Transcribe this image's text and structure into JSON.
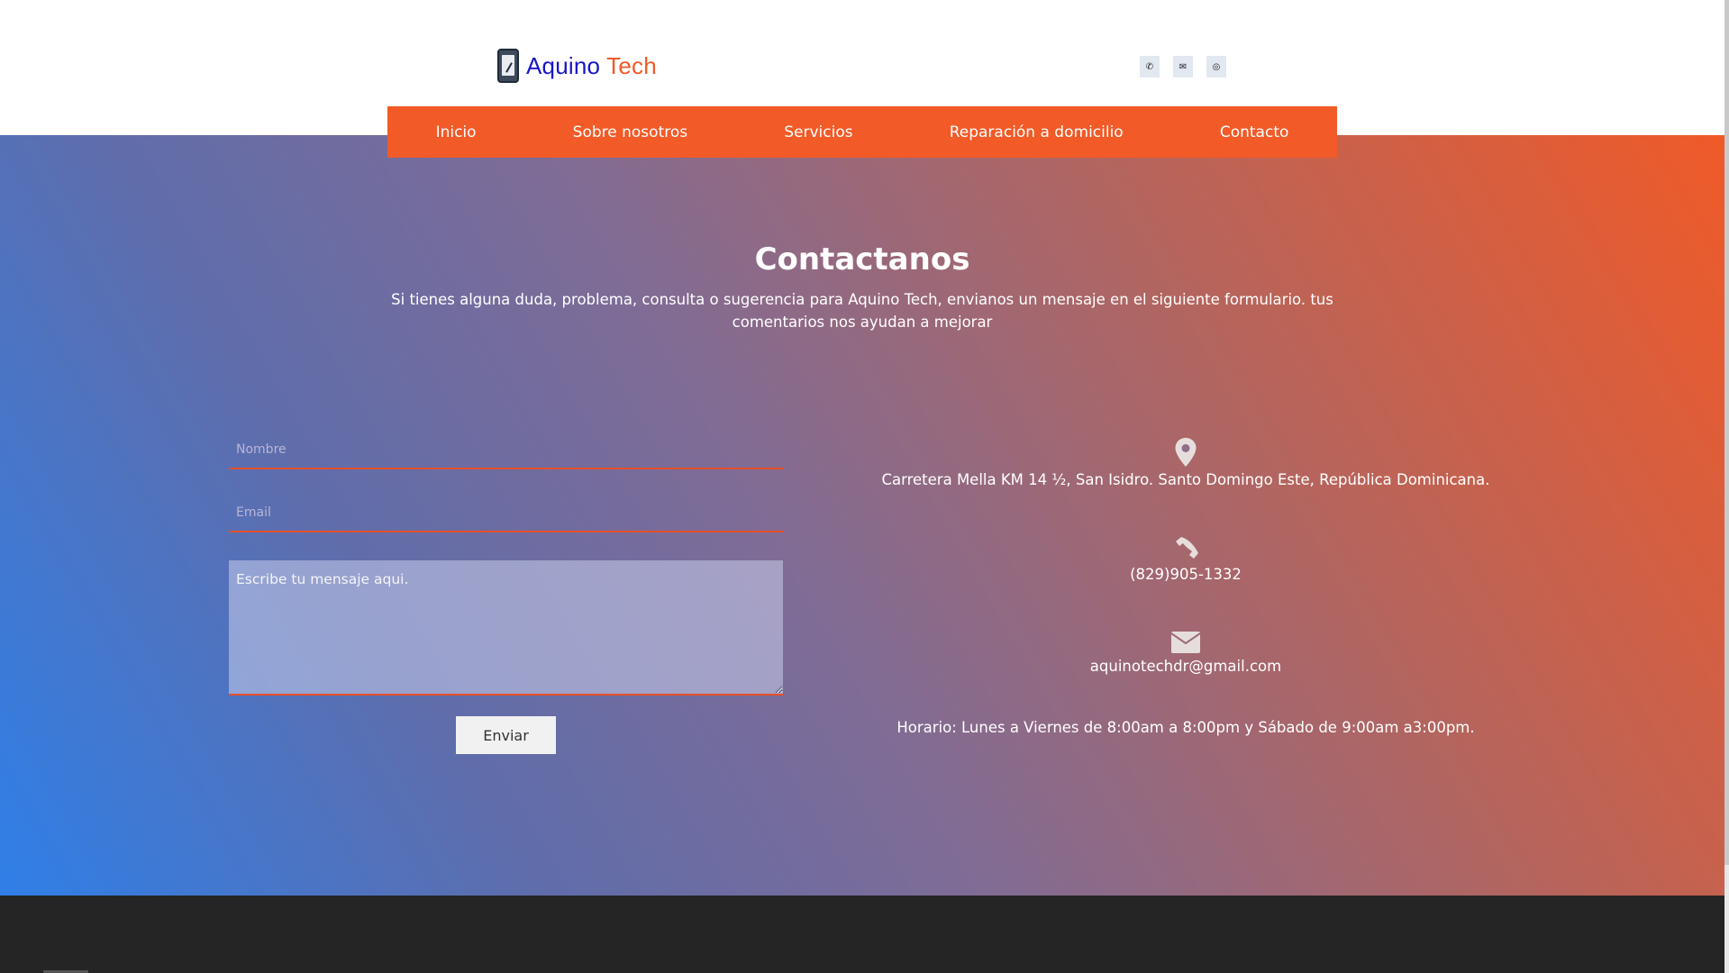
{
  "brand": {
    "name_part1": "Aquino",
    "name_part2": "Tech"
  },
  "social": [
    {
      "icon": "whatsapp-icon",
      "glyph": "✆"
    },
    {
      "icon": "mail-icon",
      "glyph": "✉"
    },
    {
      "icon": "instagram-icon",
      "glyph": "◎"
    }
  ],
  "nav": {
    "items": [
      "Inicio",
      "Sobre nosotros",
      "Servicios",
      "Reparación a domicilio",
      "Contacto"
    ]
  },
  "contact": {
    "title": "Contactanos",
    "subtitle": "Si tienes alguna duda, problema, consulta o sugerencia para Aquino Tech, envianos un mensaje en el siguiente formulario. tus comentarios nos ayudan a mejorar"
  },
  "form": {
    "name_placeholder": "Nombre",
    "email_placeholder": "Email",
    "message_placeholder": "Escribe tu mensaje aqui.",
    "submit_label": "Enviar"
  },
  "info": {
    "address": "Carretera Mella KM 14 ½, San Isidro. Santo Domingo Este, República Dominicana.",
    "phone": "(829)905-1332",
    "email": "aquinotechdr@gmail.com",
    "hours": "Horario: Lunes a Viernes de 8:00am a 8:00pm y Sábado de 9:00am a3:00pm."
  },
  "colors": {
    "brand_blue": "#1815c8",
    "brand_orange": "#f05a28",
    "nav_bg": "#f25a27",
    "footer_bg": "#252525"
  }
}
